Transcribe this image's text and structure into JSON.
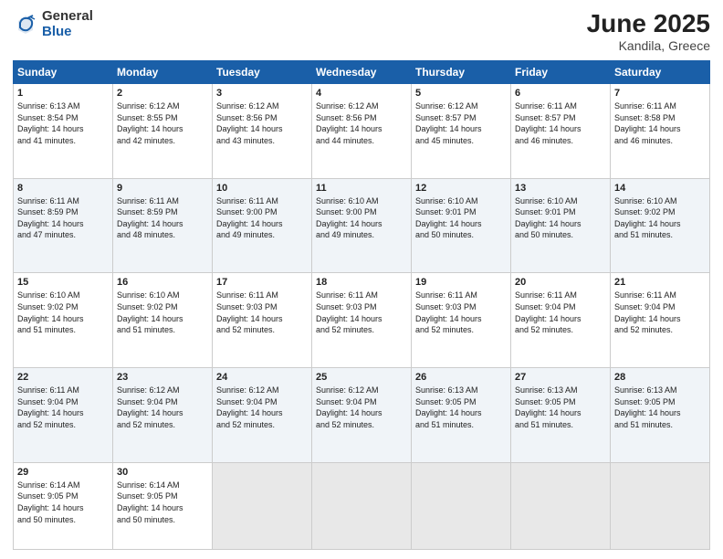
{
  "header": {
    "logo_general": "General",
    "logo_blue": "Blue",
    "title": "June 2025",
    "location": "Kandila, Greece"
  },
  "weekdays": [
    "Sunday",
    "Monday",
    "Tuesday",
    "Wednesday",
    "Thursday",
    "Friday",
    "Saturday"
  ],
  "weeks": [
    [
      {
        "day": 1,
        "sunrise": "6:13 AM",
        "sunset": "8:54 PM",
        "hours": "14 hours",
        "mins": "41 minutes."
      },
      {
        "day": 2,
        "sunrise": "6:12 AM",
        "sunset": "8:55 PM",
        "hours": "14 hours",
        "mins": "42 minutes."
      },
      {
        "day": 3,
        "sunrise": "6:12 AM",
        "sunset": "8:56 PM",
        "hours": "14 hours",
        "mins": "43 minutes."
      },
      {
        "day": 4,
        "sunrise": "6:12 AM",
        "sunset": "8:56 PM",
        "hours": "14 hours",
        "mins": "44 minutes."
      },
      {
        "day": 5,
        "sunrise": "6:12 AM",
        "sunset": "8:57 PM",
        "hours": "14 hours",
        "mins": "45 minutes."
      },
      {
        "day": 6,
        "sunrise": "6:11 AM",
        "sunset": "8:57 PM",
        "hours": "14 hours",
        "mins": "46 minutes."
      },
      {
        "day": 7,
        "sunrise": "6:11 AM",
        "sunset": "8:58 PM",
        "hours": "14 hours",
        "mins": "46 minutes."
      }
    ],
    [
      {
        "day": 8,
        "sunrise": "6:11 AM",
        "sunset": "8:59 PM",
        "hours": "14 hours",
        "mins": "47 minutes."
      },
      {
        "day": 9,
        "sunrise": "6:11 AM",
        "sunset": "8:59 PM",
        "hours": "14 hours",
        "mins": "48 minutes."
      },
      {
        "day": 10,
        "sunrise": "6:11 AM",
        "sunset": "9:00 PM",
        "hours": "14 hours",
        "mins": "49 minutes."
      },
      {
        "day": 11,
        "sunrise": "6:10 AM",
        "sunset": "9:00 PM",
        "hours": "14 hours",
        "mins": "49 minutes."
      },
      {
        "day": 12,
        "sunrise": "6:10 AM",
        "sunset": "9:01 PM",
        "hours": "14 hours",
        "mins": "50 minutes."
      },
      {
        "day": 13,
        "sunrise": "6:10 AM",
        "sunset": "9:01 PM",
        "hours": "14 hours",
        "mins": "50 minutes."
      },
      {
        "day": 14,
        "sunrise": "6:10 AM",
        "sunset": "9:02 PM",
        "hours": "14 hours",
        "mins": "51 minutes."
      }
    ],
    [
      {
        "day": 15,
        "sunrise": "6:10 AM",
        "sunset": "9:02 PM",
        "hours": "14 hours",
        "mins": "51 minutes."
      },
      {
        "day": 16,
        "sunrise": "6:10 AM",
        "sunset": "9:02 PM",
        "hours": "14 hours",
        "mins": "51 minutes."
      },
      {
        "day": 17,
        "sunrise": "6:11 AM",
        "sunset": "9:03 PM",
        "hours": "14 hours",
        "mins": "52 minutes."
      },
      {
        "day": 18,
        "sunrise": "6:11 AM",
        "sunset": "9:03 PM",
        "hours": "14 hours",
        "mins": "52 minutes."
      },
      {
        "day": 19,
        "sunrise": "6:11 AM",
        "sunset": "9:03 PM",
        "hours": "14 hours",
        "mins": "52 minutes."
      },
      {
        "day": 20,
        "sunrise": "6:11 AM",
        "sunset": "9:04 PM",
        "hours": "14 hours",
        "mins": "52 minutes."
      },
      {
        "day": 21,
        "sunrise": "6:11 AM",
        "sunset": "9:04 PM",
        "hours": "14 hours",
        "mins": "52 minutes."
      }
    ],
    [
      {
        "day": 22,
        "sunrise": "6:11 AM",
        "sunset": "9:04 PM",
        "hours": "14 hours",
        "mins": "52 minutes."
      },
      {
        "day": 23,
        "sunrise": "6:12 AM",
        "sunset": "9:04 PM",
        "hours": "14 hours",
        "mins": "52 minutes."
      },
      {
        "day": 24,
        "sunrise": "6:12 AM",
        "sunset": "9:04 PM",
        "hours": "14 hours",
        "mins": "52 minutes."
      },
      {
        "day": 25,
        "sunrise": "6:12 AM",
        "sunset": "9:04 PM",
        "hours": "14 hours",
        "mins": "52 minutes."
      },
      {
        "day": 26,
        "sunrise": "6:13 AM",
        "sunset": "9:05 PM",
        "hours": "14 hours",
        "mins": "51 minutes."
      },
      {
        "day": 27,
        "sunrise": "6:13 AM",
        "sunset": "9:05 PM",
        "hours": "14 hours",
        "mins": "51 minutes."
      },
      {
        "day": 28,
        "sunrise": "6:13 AM",
        "sunset": "9:05 PM",
        "hours": "14 hours",
        "mins": "51 minutes."
      }
    ],
    [
      {
        "day": 29,
        "sunrise": "6:14 AM",
        "sunset": "9:05 PM",
        "hours": "14 hours",
        "mins": "50 minutes."
      },
      {
        "day": 30,
        "sunrise": "6:14 AM",
        "sunset": "9:05 PM",
        "hours": "14 hours",
        "mins": "50 minutes."
      },
      null,
      null,
      null,
      null,
      null
    ]
  ]
}
